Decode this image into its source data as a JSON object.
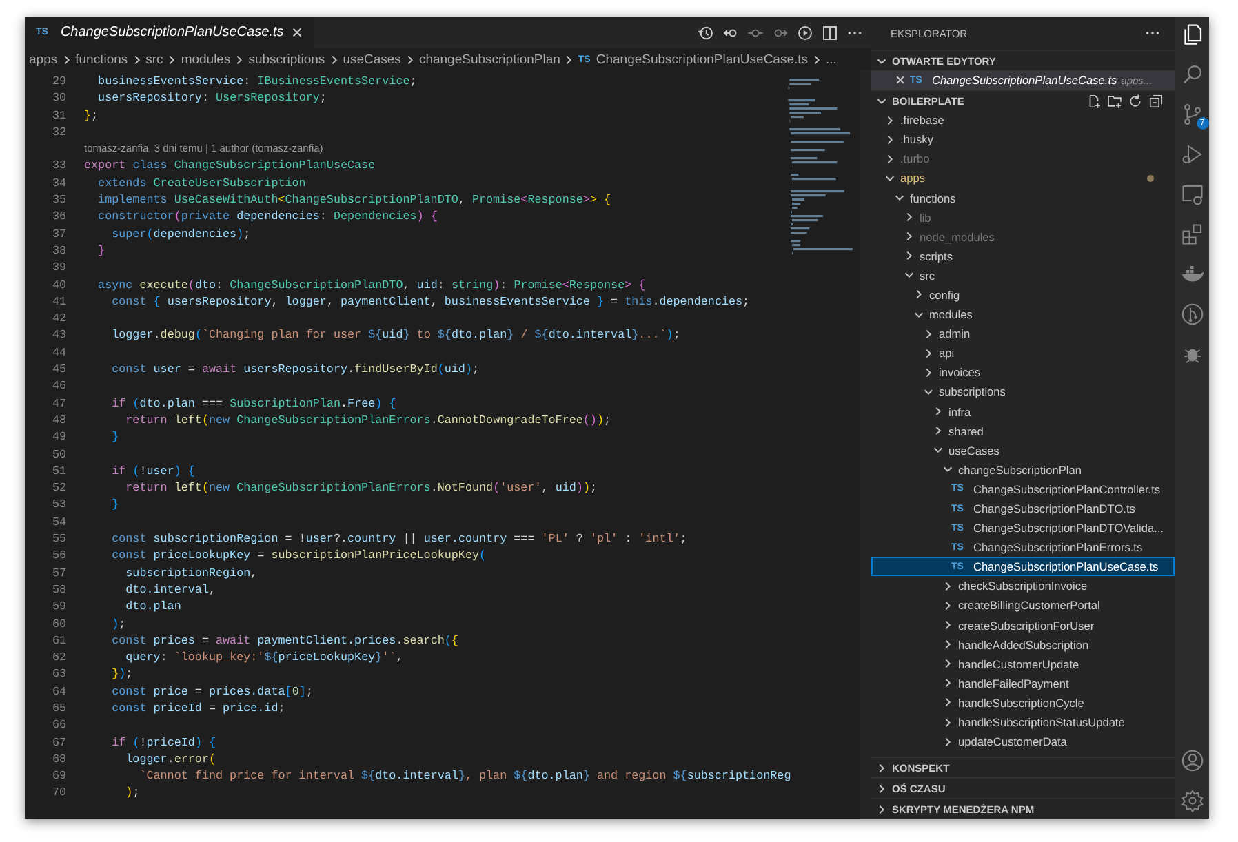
{
  "editor": {
    "tabs": [
      {
        "badge": "TS",
        "label": "ChangeSubscriptionPlanUseCase.ts",
        "selected": true
      }
    ],
    "breadcrumbs": [
      {
        "label": "apps"
      },
      {
        "label": "functions"
      },
      {
        "label": "src"
      },
      {
        "label": "modules"
      },
      {
        "label": "subscriptions"
      },
      {
        "label": "useCases"
      },
      {
        "label": "changeSubscriptionPlan"
      },
      {
        "label": "ChangeSubscriptionPlanUseCase.ts",
        "badge": "TS"
      },
      {
        "label": "..."
      }
    ],
    "lines": [
      {
        "kind": "code",
        "number": "29",
        "tokens": [
          {
            "text": "  businessEventsService",
            "kind": "var"
          },
          {
            "text": ": "
          },
          {
            "text": "IBusinessEventsService",
            "kind": "type"
          },
          {
            "text": ";"
          }
        ]
      },
      {
        "kind": "code",
        "number": "30",
        "tokens": [
          {
            "text": "  usersRepository",
            "kind": "var"
          },
          {
            "text": ": "
          },
          {
            "text": "UsersRepository",
            "kind": "type"
          },
          {
            "text": ";"
          }
        ]
      },
      {
        "kind": "code",
        "number": "31",
        "tokens": [
          {
            "text": "}",
            "kind": "b1"
          },
          {
            "text": ";"
          }
        ]
      },
      {
        "kind": "code",
        "number": "32"
      },
      {
        "kind": "codelens",
        "text": "tomasz-zanfia, 3 dni temu | 1 author (tomasz-zanfia)"
      },
      {
        "kind": "code",
        "number": "33",
        "tokens": [
          {
            "text": "export ",
            "kind": "ctrl"
          },
          {
            "text": "class ",
            "kind": "kw"
          },
          {
            "text": "ChangeSubscriptionPlanUseCase",
            "kind": "type"
          }
        ]
      },
      {
        "kind": "code",
        "number": "34",
        "tokens": [
          {
            "text": "  extends ",
            "kind": "kw"
          },
          {
            "text": "CreateUserSubscription",
            "kind": "type"
          }
        ]
      },
      {
        "kind": "code",
        "number": "35",
        "tokens": [
          {
            "text": "  implements ",
            "kind": "kw"
          },
          {
            "text": "UseCaseWithAuth",
            "kind": "type"
          },
          {
            "text": "<",
            "kind": "b1"
          },
          {
            "text": "ChangeSubscriptionPlanDTO",
            "kind": "type"
          },
          {
            "text": ", "
          },
          {
            "text": "Promise",
            "kind": "type"
          },
          {
            "text": "<",
            "kind": "b2"
          },
          {
            "text": "Response",
            "kind": "type"
          },
          {
            "text": ">",
            "kind": "b2"
          },
          {
            "text": ">",
            "kind": "b1"
          },
          {
            "text": " {",
            "kind": "b1"
          }
        ]
      },
      {
        "kind": "code",
        "number": "36",
        "tokens": [
          {
            "text": "  constructor",
            "kind": "kw"
          },
          {
            "text": "(",
            "kind": "b2"
          },
          {
            "text": "private ",
            "kind": "kw"
          },
          {
            "text": "dependencies",
            "kind": "var"
          },
          {
            "text": ": "
          },
          {
            "text": "Dependencies",
            "kind": "type"
          },
          {
            "text": ")",
            "kind": "b2"
          },
          {
            "text": " {",
            "kind": "b2"
          }
        ]
      },
      {
        "kind": "code",
        "number": "37",
        "tokens": [
          {
            "text": "    super",
            "kind": "kw"
          },
          {
            "text": "(",
            "kind": "b3"
          },
          {
            "text": "dependencies",
            "kind": "var"
          },
          {
            "text": ")",
            "kind": "b3"
          },
          {
            "text": ";"
          }
        ]
      },
      {
        "kind": "code",
        "number": "38",
        "tokens": [
          {
            "text": "  }",
            "kind": "b2"
          }
        ]
      },
      {
        "kind": "code",
        "number": "39"
      },
      {
        "kind": "code",
        "number": "40",
        "tokens": [
          {
            "text": "  async ",
            "kind": "kw"
          },
          {
            "text": "execute",
            "kind": "fn"
          },
          {
            "text": "(",
            "kind": "b2"
          },
          {
            "text": "dto",
            "kind": "var"
          },
          {
            "text": ": "
          },
          {
            "text": "ChangeSubscriptionPlanDTO",
            "kind": "type"
          },
          {
            "text": ", "
          },
          {
            "text": "uid",
            "kind": "var"
          },
          {
            "text": ": "
          },
          {
            "text": "string",
            "kind": "type"
          },
          {
            "text": ")",
            "kind": "b2"
          },
          {
            "text": ": "
          },
          {
            "text": "Promise",
            "kind": "type"
          },
          {
            "text": "<",
            "kind": "b2"
          },
          {
            "text": "Response",
            "kind": "type"
          },
          {
            "text": ">",
            "kind": "b2"
          },
          {
            "text": " {",
            "kind": "b2"
          }
        ]
      },
      {
        "kind": "code",
        "number": "41",
        "tokens": [
          {
            "text": "    const ",
            "kind": "kw"
          },
          {
            "text": "{ ",
            "kind": "b3"
          },
          {
            "text": "usersRepository",
            "kind": "var"
          },
          {
            "text": ", "
          },
          {
            "text": "logger",
            "kind": "var"
          },
          {
            "text": ", "
          },
          {
            "text": "paymentClient",
            "kind": "var"
          },
          {
            "text": ", "
          },
          {
            "text": "businessEventsService",
            "kind": "var"
          },
          {
            "text": " }",
            "kind": "b3"
          },
          {
            "text": " = "
          },
          {
            "text": "this",
            "kind": "kw"
          },
          {
            "text": "."
          },
          {
            "text": "dependencies",
            "kind": "var"
          },
          {
            "text": ";"
          }
        ]
      },
      {
        "kind": "code",
        "number": "42"
      },
      {
        "kind": "code",
        "number": "43",
        "tokens": [
          {
            "text": "    logger",
            "kind": "var"
          },
          {
            "text": "."
          },
          {
            "text": "debug",
            "kind": "fn"
          },
          {
            "text": "(",
            "kind": "b3"
          },
          {
            "text": "`Changing plan for user ",
            "kind": "str"
          },
          {
            "text": "${",
            "kind": "kw"
          },
          {
            "text": "uid",
            "kind": "var"
          },
          {
            "text": "}",
            "kind": "kw"
          },
          {
            "text": " to ",
            "kind": "str"
          },
          {
            "text": "${",
            "kind": "kw"
          },
          {
            "text": "dto.plan",
            "kind": "var"
          },
          {
            "text": "}",
            "kind": "kw"
          },
          {
            "text": " / ",
            "kind": "str"
          },
          {
            "text": "${",
            "kind": "kw"
          },
          {
            "text": "dto.interval",
            "kind": "var"
          },
          {
            "text": "}",
            "kind": "kw"
          },
          {
            "text": "...`",
            "kind": "str"
          },
          {
            "text": ")",
            "kind": "b3"
          },
          {
            "text": ";"
          }
        ]
      },
      {
        "kind": "code",
        "number": "44"
      },
      {
        "kind": "code",
        "number": "45",
        "tokens": [
          {
            "text": "    const ",
            "kind": "kw"
          },
          {
            "text": "user",
            "kind": "var"
          },
          {
            "text": " = "
          },
          {
            "text": "await ",
            "kind": "ctrl"
          },
          {
            "text": "usersRepository",
            "kind": "var"
          },
          {
            "text": "."
          },
          {
            "text": "findUserById",
            "kind": "fn"
          },
          {
            "text": "(",
            "kind": "b3"
          },
          {
            "text": "uid",
            "kind": "var"
          },
          {
            "text": ")",
            "kind": "b3"
          },
          {
            "text": ";"
          }
        ]
      },
      {
        "kind": "code",
        "number": "46"
      },
      {
        "kind": "code",
        "number": "47",
        "tokens": [
          {
            "text": "    if ",
            "kind": "ctrl"
          },
          {
            "text": "(",
            "kind": "b3"
          },
          {
            "text": "dto.plan",
            "kind": "var"
          },
          {
            "text": " === "
          },
          {
            "text": "SubscriptionPlan",
            "kind": "type"
          },
          {
            "text": "."
          },
          {
            "text": "Free",
            "kind": "var"
          },
          {
            "text": ")",
            "kind": "b3"
          },
          {
            "text": " {",
            "kind": "b3"
          }
        ]
      },
      {
        "kind": "code",
        "number": "48",
        "tokens": [
          {
            "text": "      return ",
            "kind": "ctrl"
          },
          {
            "text": "left",
            "kind": "fn"
          },
          {
            "text": "(",
            "kind": "b1"
          },
          {
            "text": "new ",
            "kind": "kw"
          },
          {
            "text": "ChangeSubscriptionPlanErrors",
            "kind": "type"
          },
          {
            "text": "."
          },
          {
            "text": "CannotDowngradeToFree",
            "kind": "fn"
          },
          {
            "text": "()",
            "kind": "b2"
          },
          {
            "text": ")",
            "kind": "b1"
          },
          {
            "text": ";"
          }
        ]
      },
      {
        "kind": "code",
        "number": "49",
        "tokens": [
          {
            "text": "    }",
            "kind": "b3"
          }
        ]
      },
      {
        "kind": "code",
        "number": "50"
      },
      {
        "kind": "code",
        "number": "51",
        "tokens": [
          {
            "text": "    if ",
            "kind": "ctrl"
          },
          {
            "text": "(",
            "kind": "b3"
          },
          {
            "text": "!"
          },
          {
            "text": "user",
            "kind": "var"
          },
          {
            "text": ")",
            "kind": "b3"
          },
          {
            "text": " {",
            "kind": "b3"
          }
        ]
      },
      {
        "kind": "code",
        "number": "52",
        "tokens": [
          {
            "text": "      return ",
            "kind": "ctrl"
          },
          {
            "text": "left",
            "kind": "fn"
          },
          {
            "text": "(",
            "kind": "b1"
          },
          {
            "text": "new ",
            "kind": "kw"
          },
          {
            "text": "ChangeSubscriptionPlanErrors",
            "kind": "type"
          },
          {
            "text": "."
          },
          {
            "text": "NotFound",
            "kind": "fn"
          },
          {
            "text": "(",
            "kind": "b2"
          },
          {
            "text": "'user'",
            "kind": "str"
          },
          {
            "text": ", "
          },
          {
            "text": "uid",
            "kind": "var"
          },
          {
            "text": ")",
            "kind": "b2"
          },
          {
            "text": ")",
            "kind": "b1"
          },
          {
            "text": ";"
          }
        ]
      },
      {
        "kind": "code",
        "number": "53",
        "tokens": [
          {
            "text": "    }",
            "kind": "b3"
          }
        ]
      },
      {
        "kind": "code",
        "number": "54"
      },
      {
        "kind": "code",
        "number": "55",
        "tokens": [
          {
            "text": "    const ",
            "kind": "kw"
          },
          {
            "text": "subscriptionRegion",
            "kind": "var"
          },
          {
            "text": " = !"
          },
          {
            "text": "user",
            "kind": "var"
          },
          {
            "text": "?."
          },
          {
            "text": "country",
            "kind": "var"
          },
          {
            "text": " || "
          },
          {
            "text": "user.country",
            "kind": "var"
          },
          {
            "text": " === "
          },
          {
            "text": "'PL'",
            "kind": "str"
          },
          {
            "text": " ? "
          },
          {
            "text": "'pl'",
            "kind": "str"
          },
          {
            "text": " : "
          },
          {
            "text": "'intl'",
            "kind": "str"
          },
          {
            "text": ";"
          }
        ]
      },
      {
        "kind": "code",
        "number": "56",
        "tokens": [
          {
            "text": "    const ",
            "kind": "kw"
          },
          {
            "text": "priceLookupKey",
            "kind": "var"
          },
          {
            "text": " = "
          },
          {
            "text": "subscriptionPlanPriceLookupKey",
            "kind": "fn"
          },
          {
            "text": "(",
            "kind": "b3"
          }
        ]
      },
      {
        "kind": "code",
        "number": "57",
        "tokens": [
          {
            "text": "      subscriptionRegion",
            "kind": "var"
          },
          {
            "text": ","
          }
        ]
      },
      {
        "kind": "code",
        "number": "58",
        "tokens": [
          {
            "text": "      dto.interval",
            "kind": "var"
          },
          {
            "text": ","
          }
        ]
      },
      {
        "kind": "code",
        "number": "59",
        "tokens": [
          {
            "text": "      dto.plan",
            "kind": "var"
          }
        ]
      },
      {
        "kind": "code",
        "number": "60",
        "tokens": [
          {
            "text": "    )",
            "kind": "b3"
          },
          {
            "text": ";"
          }
        ]
      },
      {
        "kind": "code",
        "number": "61",
        "tokens": [
          {
            "text": "    const ",
            "kind": "kw"
          },
          {
            "text": "prices",
            "kind": "var"
          },
          {
            "text": " = "
          },
          {
            "text": "await ",
            "kind": "ctrl"
          },
          {
            "text": "paymentClient.prices",
            "kind": "var"
          },
          {
            "text": "."
          },
          {
            "text": "search",
            "kind": "fn"
          },
          {
            "text": "(",
            "kind": "b3"
          },
          {
            "text": "{",
            "kind": "b1"
          }
        ]
      },
      {
        "kind": "code",
        "number": "62",
        "tokens": [
          {
            "text": "      query",
            "kind": "var"
          },
          {
            "text": ": "
          },
          {
            "text": "`lookup_key:'",
            "kind": "str"
          },
          {
            "text": "${",
            "kind": "kw"
          },
          {
            "text": "priceLookupKey",
            "kind": "var"
          },
          {
            "text": "}",
            "kind": "kw"
          },
          {
            "text": "'`",
            "kind": "str"
          },
          {
            "text": ","
          }
        ]
      },
      {
        "kind": "code",
        "number": "63",
        "tokens": [
          {
            "text": "    }",
            "kind": "b1"
          },
          {
            "text": ")",
            "kind": "b3"
          },
          {
            "text": ";"
          }
        ]
      },
      {
        "kind": "code",
        "number": "64",
        "tokens": [
          {
            "text": "    const ",
            "kind": "kw"
          },
          {
            "text": "price",
            "kind": "var"
          },
          {
            "text": " = "
          },
          {
            "text": "prices.data",
            "kind": "var"
          },
          {
            "text": "[",
            "kind": "b3"
          },
          {
            "text": "0",
            "kind": "num"
          },
          {
            "text": "]",
            "kind": "b3"
          },
          {
            "text": ";"
          }
        ]
      },
      {
        "kind": "code",
        "number": "65",
        "tokens": [
          {
            "text": "    const ",
            "kind": "kw"
          },
          {
            "text": "priceId",
            "kind": "var"
          },
          {
            "text": " = "
          },
          {
            "text": "price.id",
            "kind": "var"
          },
          {
            "text": ";"
          }
        ]
      },
      {
        "kind": "code",
        "number": "66"
      },
      {
        "kind": "code",
        "number": "67",
        "tokens": [
          {
            "text": "    if ",
            "kind": "ctrl"
          },
          {
            "text": "(",
            "kind": "b3"
          },
          {
            "text": "!"
          },
          {
            "text": "priceId",
            "kind": "var"
          },
          {
            "text": ")",
            "kind": "b3"
          },
          {
            "text": " {",
            "kind": "b3"
          }
        ]
      },
      {
        "kind": "code",
        "number": "68",
        "tokens": [
          {
            "text": "      logger",
            "kind": "var"
          },
          {
            "text": "."
          },
          {
            "text": "error",
            "kind": "fn"
          },
          {
            "text": "(",
            "kind": "b1"
          }
        ]
      },
      {
        "kind": "code",
        "number": "69",
        "tokens": [
          {
            "text": "        `Cannot find price for interval ",
            "kind": "str"
          },
          {
            "text": "${",
            "kind": "kw"
          },
          {
            "text": "dto.interval",
            "kind": "var"
          },
          {
            "text": "}",
            "kind": "kw"
          },
          {
            "text": ", plan ",
            "kind": "str"
          },
          {
            "text": "${",
            "kind": "kw"
          },
          {
            "text": "dto.plan",
            "kind": "var"
          },
          {
            "text": "}",
            "kind": "kw"
          },
          {
            "text": " and region ",
            "kind": "str"
          },
          {
            "text": "${",
            "kind": "kw"
          },
          {
            "text": "subscriptionReg",
            "kind": "var"
          }
        ]
      },
      {
        "kind": "code",
        "number": "70",
        "tokens": [
          {
            "text": "      )",
            "kind": "b1"
          },
          {
            "text": ";"
          }
        ]
      }
    ]
  },
  "sidebar": {
    "title": "EKSPLORATOR",
    "sections": [
      {
        "kind": "open_editors",
        "title": "OTWARTE EDYTORY",
        "expanded": true,
        "items": [
          {
            "badge": "TS",
            "label": "ChangeSubscriptionPlanUseCase.ts",
            "description": "apps...",
            "selected": true
          }
        ]
      },
      {
        "kind": "tree",
        "title": "BOILERPLATE",
        "expanded": true,
        "tree": [
          {
            "kind": "folder",
            "label": ".firebase",
            "expanded": false,
            "dimmed": false,
            "modified": false,
            "selected": false
          },
          {
            "kind": "folder",
            "label": ".husky",
            "expanded": false,
            "dimmed": false,
            "modified": false,
            "selected": false
          },
          {
            "kind": "folder",
            "label": ".turbo",
            "expanded": false,
            "dimmed": true,
            "modified": false,
            "selected": false
          },
          {
            "kind": "folder",
            "label": "apps",
            "expanded": true,
            "dimmed": false,
            "modified": true,
            "selected": false,
            "children": [
              {
                "kind": "folder",
                "label": "functions",
                "expanded": true,
                "dimmed": false,
                "modified": false,
                "selected": false,
                "children": [
                  {
                    "kind": "folder",
                    "label": "lib",
                    "expanded": false,
                    "dimmed": true,
                    "modified": false,
                    "selected": false
                  },
                  {
                    "kind": "folder",
                    "label": "node_modules",
                    "expanded": false,
                    "dimmed": true,
                    "modified": false,
                    "selected": false
                  },
                  {
                    "kind": "folder",
                    "label": "scripts",
                    "expanded": false,
                    "dimmed": false,
                    "modified": false,
                    "selected": false
                  },
                  {
                    "kind": "folder",
                    "label": "src",
                    "expanded": true,
                    "dimmed": false,
                    "modified": false,
                    "selected": false,
                    "children": [
                      {
                        "kind": "folder",
                        "label": "config",
                        "expanded": false,
                        "dimmed": false,
                        "modified": false,
                        "selected": false
                      },
                      {
                        "kind": "folder",
                        "label": "modules",
                        "expanded": true,
                        "dimmed": false,
                        "modified": false,
                        "selected": false,
                        "children": [
                          {
                            "kind": "folder",
                            "label": "admin",
                            "expanded": false,
                            "dimmed": false,
                            "modified": false,
                            "selected": false
                          },
                          {
                            "kind": "folder",
                            "label": "api",
                            "expanded": false,
                            "dimmed": false,
                            "modified": false,
                            "selected": false
                          },
                          {
                            "kind": "folder",
                            "label": "invoices",
                            "expanded": false,
                            "dimmed": false,
                            "modified": false,
                            "selected": false
                          },
                          {
                            "kind": "folder",
                            "label": "subscriptions",
                            "expanded": true,
                            "dimmed": false,
                            "modified": false,
                            "selected": false,
                            "children": [
                              {
                                "kind": "folder",
                                "label": "infra",
                                "expanded": false,
                                "dimmed": false,
                                "modified": false,
                                "selected": false
                              },
                              {
                                "kind": "folder",
                                "label": "shared",
                                "expanded": false,
                                "dimmed": false,
                                "modified": false,
                                "selected": false
                              },
                              {
                                "kind": "folder",
                                "label": "useCases",
                                "expanded": true,
                                "dimmed": false,
                                "modified": false,
                                "selected": false,
                                "children": [
                                  {
                                    "kind": "folder",
                                    "label": "changeSubscriptionPlan",
                                    "expanded": true,
                                    "dimmed": false,
                                    "modified": false,
                                    "selected": false,
                                    "children": [
                                      {
                                        "kind": "file",
                                        "badge": "TS",
                                        "label": "ChangeSubscriptionPlanController.ts",
                                        "dimmed": false,
                                        "modified": false,
                                        "selected": false
                                      },
                                      {
                                        "kind": "file",
                                        "badge": "TS",
                                        "label": "ChangeSubscriptionPlanDTO.ts",
                                        "dimmed": false,
                                        "modified": false,
                                        "selected": false
                                      },
                                      {
                                        "kind": "file",
                                        "badge": "TS",
                                        "label": "ChangeSubscriptionPlanDTOValida...",
                                        "dimmed": false,
                                        "modified": false,
                                        "selected": false
                                      },
                                      {
                                        "kind": "file",
                                        "badge": "TS",
                                        "label": "ChangeSubscriptionPlanErrors.ts",
                                        "dimmed": false,
                                        "modified": false,
                                        "selected": false
                                      },
                                      {
                                        "kind": "file",
                                        "badge": "TS",
                                        "label": "ChangeSubscriptionPlanUseCase.ts",
                                        "dimmed": false,
                                        "modified": false,
                                        "selected": true
                                      }
                                    ]
                                  },
                                  {
                                    "kind": "folder",
                                    "label": "checkSubscriptionInvoice",
                                    "expanded": false,
                                    "dimmed": false,
                                    "modified": false,
                                    "selected": false
                                  },
                                  {
                                    "kind": "folder",
                                    "label": "createBillingCustomerPortal",
                                    "expanded": false,
                                    "dimmed": false,
                                    "modified": false,
                                    "selected": false
                                  },
                                  {
                                    "kind": "folder",
                                    "label": "createSubscriptionForUser",
                                    "expanded": false,
                                    "dimmed": false,
                                    "modified": false,
                                    "selected": false
                                  },
                                  {
                                    "kind": "folder",
                                    "label": "handleAddedSubscription",
                                    "expanded": false,
                                    "dimmed": false,
                                    "modified": false,
                                    "selected": false
                                  },
                                  {
                                    "kind": "folder",
                                    "label": "handleCustomerUpdate",
                                    "expanded": false,
                                    "dimmed": false,
                                    "modified": false,
                                    "selected": false
                                  },
                                  {
                                    "kind": "folder",
                                    "label": "handleFailedPayment",
                                    "expanded": false,
                                    "dimmed": false,
                                    "modified": false,
                                    "selected": false
                                  },
                                  {
                                    "kind": "folder",
                                    "label": "handleSubscriptionCycle",
                                    "expanded": false,
                                    "dimmed": false,
                                    "modified": false,
                                    "selected": false
                                  },
                                  {
                                    "kind": "folder",
                                    "label": "handleSubscriptionStatusUpdate",
                                    "expanded": false,
                                    "dimmed": false,
                                    "modified": false,
                                    "selected": false
                                  },
                                  {
                                    "kind": "folder",
                                    "label": "updateCustomerData",
                                    "expanded": false,
                                    "dimmed": false,
                                    "modified": false,
                                    "selected": false
                                  }
                                ]
                              }
                            ]
                          }
                        ]
                      }
                    ]
                  }
                ]
              }
            ]
          }
        ]
      },
      {
        "kind": "collapsed",
        "title": "KONSPEKT",
        "expanded": false
      },
      {
        "kind": "collapsed",
        "title": "OŚ CZASU",
        "expanded": false
      },
      {
        "kind": "collapsed",
        "title": "SKRYPTY MENEDŻERA NPM",
        "expanded": false
      }
    ]
  },
  "activity_bar": {
    "items": [
      {
        "kind": "explorer",
        "selected": true
      },
      {
        "kind": "search",
        "selected": false
      },
      {
        "kind": "source_control",
        "selected": false,
        "badge": "7"
      },
      {
        "kind": "run_debug",
        "selected": false
      },
      {
        "kind": "remote",
        "selected": false
      },
      {
        "kind": "extensions",
        "selected": false
      },
      {
        "kind": "docker",
        "selected": false
      },
      {
        "kind": "git_graph",
        "selected": false
      },
      {
        "kind": "bug",
        "selected": false
      }
    ],
    "bottom_items": [
      {
        "kind": "account",
        "selected": false
      },
      {
        "kind": "settings",
        "selected": false
      }
    ]
  }
}
